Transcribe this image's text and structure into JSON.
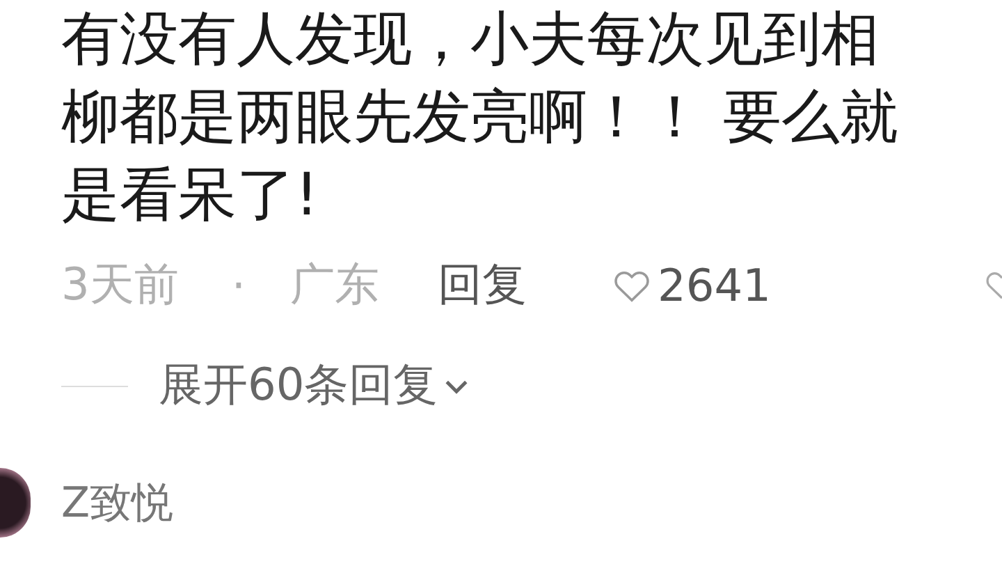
{
  "comment": {
    "text": "有没有人发现，小夫每次见到相柳都是两眼先发亮啊！！ 要么就是看呆了!",
    "time": "3天前",
    "separator": "·",
    "location": "广东",
    "reply": "回复",
    "likes": "2641"
  },
  "expand_replies": {
    "label": "展开60条回复",
    "expanded": false
  },
  "next_comment": {
    "username": "Z致悦"
  }
}
